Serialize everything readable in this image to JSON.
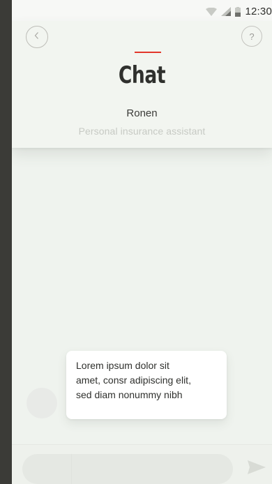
{
  "status_bar": {
    "time": "12:30"
  },
  "header": {
    "title": "Chat",
    "agent_name": "Ronen",
    "agent_role": "Personal insurance assistant",
    "help_label": "?"
  },
  "chat": {
    "messages": [
      {
        "sender": "agent",
        "text": "Lorem ipsum dolor sit\namet, consr adipiscing elit,\nsed diam nonummy nibh"
      }
    ]
  },
  "composer": {
    "placeholder": ""
  },
  "icons": {
    "back": "chevron-left-icon",
    "help": "question-icon",
    "send": "send-icon",
    "wifi": "wifi-icon",
    "signal": "signal-icon",
    "battery": "battery-icon"
  },
  "colors": {
    "accent": "#e2372b",
    "background": "#eff3ee",
    "bubble": "#ffffff",
    "title": "#2f302d",
    "subtitle": "#c7cac4"
  }
}
